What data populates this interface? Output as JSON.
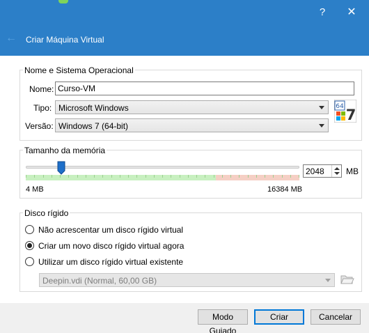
{
  "window": {
    "help_glyph": "?",
    "close_glyph": "✕"
  },
  "header": {
    "back_glyph": "←",
    "title": "Criar Máquina Virtual"
  },
  "name_os": {
    "group_title": "Nome e Sistema Operacional",
    "name_label": "Nome:",
    "name_value": "Curso-VM",
    "type_label": "Tipo:",
    "type_value": "Microsoft Windows",
    "version_label": "Versão:",
    "version_value": "Windows 7 (64-bit)",
    "os_icon": {
      "name": "windows-7-64bit-icon",
      "badge": "64",
      "digit": "7"
    }
  },
  "memory": {
    "group_title": "Tamanho da memória",
    "min_label": "4 MB",
    "max_label": "16384 MB",
    "min_mb": 4,
    "max_mb": 16384,
    "value_mb": 2048,
    "value_text": "2048",
    "unit": "MB",
    "scale_colors": {
      "ok": "#c8f0c0",
      "warn": "#f5cfc4",
      "tick": "#9bcf8f"
    }
  },
  "disk": {
    "group_title": "Disco rígido",
    "options": [
      {
        "label": "Não acrescentar um disco rígido virtual",
        "checked": false
      },
      {
        "label": "Criar um novo disco rígido virtual agora",
        "checked": true
      },
      {
        "label": "Utilizar um disco rígido virtual existente",
        "checked": false
      }
    ],
    "existing_disk_value": "Deepin.vdi (Normal, 60,00 GB)"
  },
  "buttons": {
    "guided": "Modo Guiado",
    "create": "Criar",
    "cancel": "Cancelar"
  },
  "colors": {
    "titlebar": "#2c7fc8",
    "accent": "#0078d7"
  }
}
